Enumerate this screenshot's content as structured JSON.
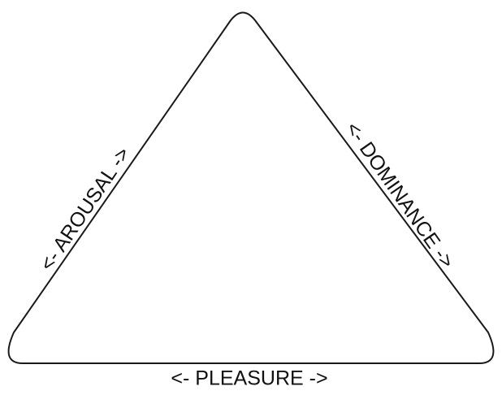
{
  "diagram": {
    "labels": {
      "left": "<- AROUSAL ->",
      "right": "<- DOMINANCE ->",
      "bottom": "<- PLEASURE ->"
    },
    "colors": {
      "stroke": "#1a1a1a",
      "text": "#111111",
      "background": "#ffffff"
    }
  }
}
